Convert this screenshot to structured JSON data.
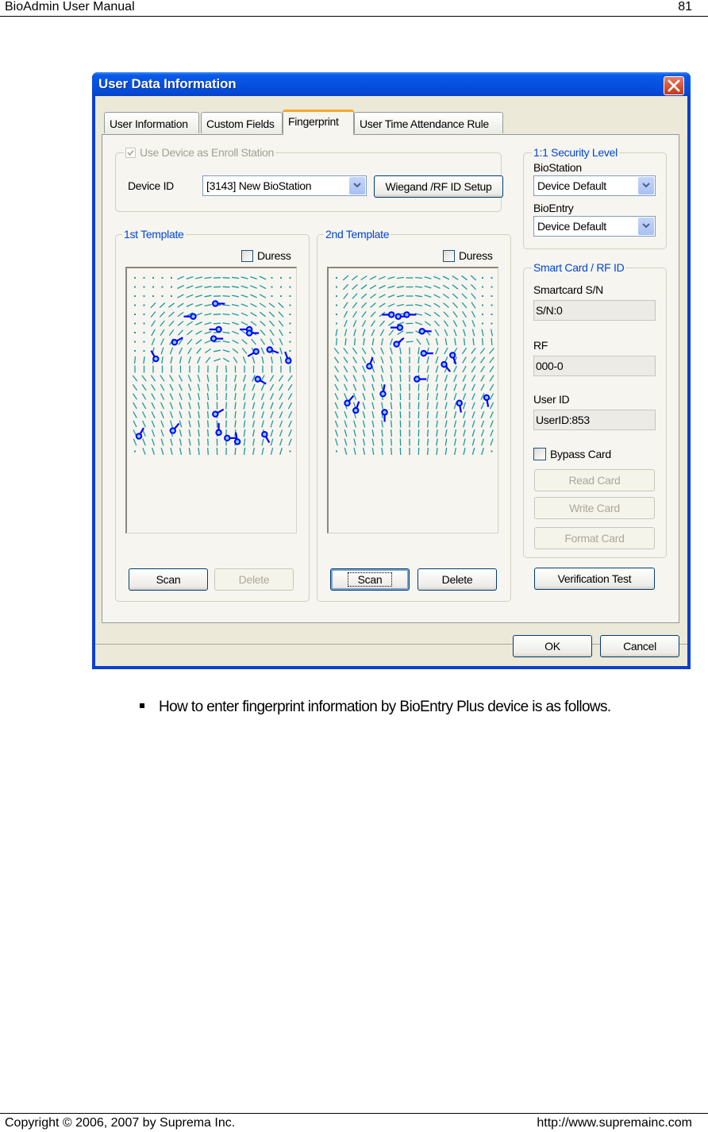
{
  "document": {
    "header_title": "BioAdmin  User  Manual",
    "page_number": "81",
    "bullet_text": "How to enter fingerprint information by BioEntry Plus device is as follows.",
    "footer_copyright": "Copyright © 2006, 2007 by Suprema Inc.",
    "footer_url": "http://www.supremainc.com"
  },
  "dialog": {
    "title": "User Data Information",
    "tabs": [
      {
        "label": "User Information",
        "active": false
      },
      {
        "label": "Custom Fields",
        "active": false
      },
      {
        "label": "Fingerprint",
        "active": true
      },
      {
        "label": "User Time Attendance Rule",
        "active": false
      }
    ],
    "enroll": {
      "checkbox_label": "Use Device as Enroll Station",
      "checked": true,
      "device_id_label": "Device ID",
      "device_id_value": "[3143] New BioStation",
      "wiegand_button": "Wiegand /RF ID Setup"
    },
    "template1": {
      "title": "1st Template",
      "duress_label": "Duress",
      "duress_checked": false,
      "scan_button": "Scan",
      "delete_button": "Delete",
      "delete_enabled": false
    },
    "template2": {
      "title": "2nd Template",
      "duress_label": "Duress",
      "duress_checked": false,
      "scan_button": "Scan",
      "delete_button": "Delete",
      "delete_enabled": true
    },
    "security": {
      "title": "1:1 Security Level",
      "biostation_label": "BioStation",
      "biostation_value": "Device Default",
      "bioentry_label": "BioEntry",
      "bioentry_value": "Device Default"
    },
    "smartcard": {
      "title": "Smart Card / RF ID",
      "sn_label": "Smartcard S/N",
      "sn_value": "S/N:0",
      "rf_label": "RF",
      "rf_value": "000-0",
      "userid_label": "User ID",
      "userid_value": "UserID:853",
      "bypass_label": "Bypass Card",
      "bypass_checked": false,
      "read_button": "Read Card",
      "write_button": "Write Card",
      "format_button": "Format Card"
    },
    "verification_button": "Verification Test",
    "ok_button": "OK",
    "cancel_button": "Cancel"
  },
  "colors": {
    "ridge": "#1a9a9a",
    "minutia": "#0000ff",
    "group_title": "#0046d5",
    "titlebar": "#0a5be8"
  },
  "fingerprints": {
    "template1": {
      "core": [
        0.55,
        0.52
      ],
      "minutiae": [
        [
          0.52,
          0.14,
          0
        ],
        [
          0.39,
          0.21,
          180
        ],
        [
          0.54,
          0.28,
          180
        ],
        [
          0.72,
          0.28,
          180
        ],
        [
          0.72,
          0.3,
          0
        ],
        [
          0.51,
          0.33,
          0
        ],
        [
          0.28,
          0.35,
          -30
        ],
        [
          0.76,
          0.4,
          150
        ],
        [
          0.84,
          0.39,
          20
        ],
        [
          0.17,
          0.44,
          -120
        ],
        [
          0.95,
          0.45,
          -110
        ],
        [
          0.77,
          0.55,
          30
        ],
        [
          0.52,
          0.74,
          -30
        ],
        [
          0.07,
          0.86,
          -60
        ],
        [
          0.27,
          0.83,
          -50
        ],
        [
          0.54,
          0.84,
          -90
        ],
        [
          0.59,
          0.87,
          0
        ],
        [
          0.65,
          0.89,
          -100
        ],
        [
          0.81,
          0.85,
          60
        ]
      ]
    },
    "template2": {
      "core": [
        0.48,
        0.4
      ],
      "minutiae": [
        [
          0.37,
          0.2,
          180
        ],
        [
          0.41,
          0.21,
          0
        ],
        [
          0.46,
          0.2,
          0
        ],
        [
          0.42,
          0.27,
          180
        ],
        [
          0.55,
          0.29,
          0
        ],
        [
          0.4,
          0.36,
          -40
        ],
        [
          0.56,
          0.41,
          0
        ],
        [
          0.73,
          0.42,
          70
        ],
        [
          0.68,
          0.47,
          50
        ],
        [
          0.24,
          0.48,
          -70
        ],
        [
          0.52,
          0.55,
          0
        ],
        [
          0.32,
          0.63,
          -80
        ],
        [
          0.11,
          0.68,
          -50
        ],
        [
          0.16,
          0.72,
          -70
        ],
        [
          0.33,
          0.73,
          90
        ],
        [
          0.77,
          0.68,
          80
        ],
        [
          0.93,
          0.65,
          80
        ]
      ]
    }
  }
}
